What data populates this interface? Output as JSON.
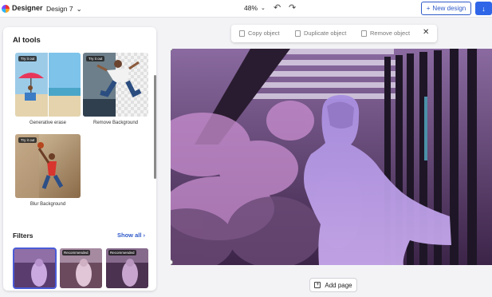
{
  "topbar": {
    "app_name": "Designer",
    "design_name": "Design 7",
    "zoom": "48%",
    "new_design_label": "New design"
  },
  "ai_tools": {
    "title": "AI tools",
    "items": [
      {
        "label": "Generative erase",
        "badge": "Try it out"
      },
      {
        "label": "Remove Background",
        "badge": "Try it out"
      },
      {
        "label": "Blur Background",
        "badge": "Try it out"
      }
    ]
  },
  "filters": {
    "title": "Filters",
    "show_all": "Show all",
    "items": [
      {
        "badge": ""
      },
      {
        "badge": "Recommended"
      },
      {
        "badge": "Recommended"
      }
    ]
  },
  "object_toolbar": {
    "copy": "Copy object",
    "duplicate": "Duplicate object",
    "remove": "Remove object"
  },
  "add_page_label": "Add page",
  "colors": {
    "accent": "#2f5ac9",
    "selection": "#8a6fd6"
  }
}
